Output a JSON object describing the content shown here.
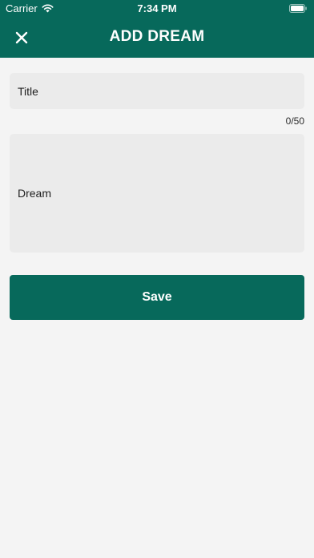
{
  "status_bar": {
    "carrier": "Carrier",
    "time": "7:34 PM",
    "wifi_icon": "wifi-icon",
    "battery_icon": "battery-icon"
  },
  "nav": {
    "title": "ADD DREAM",
    "close_icon": "close-icon"
  },
  "form": {
    "title_placeholder": "Title",
    "title_value": "",
    "char_counter": "0/50",
    "dream_placeholder": "Dream",
    "dream_value": "",
    "save_label": "Save"
  },
  "colors": {
    "primary": "#07695b",
    "background": "#f4f4f4",
    "field_background": "#ebebeb"
  }
}
